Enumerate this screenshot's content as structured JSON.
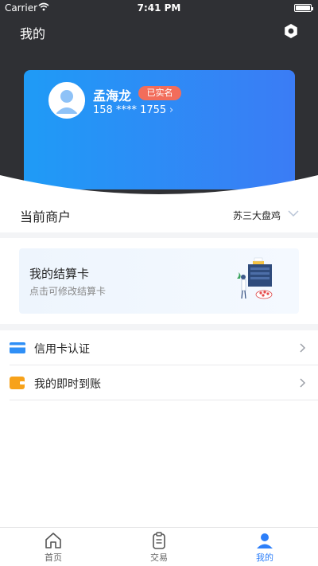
{
  "status_bar": {
    "carrier": "Carrier",
    "time": "7:41 PM"
  },
  "header": {
    "title": "我的"
  },
  "profile": {
    "name": "孟海龙",
    "badge": "已实名",
    "phone": "158 **** 1755"
  },
  "merchant": {
    "label": "当前商户",
    "value": "苏三大盘鸡"
  },
  "settlement_card": {
    "title": "我的结算卡",
    "subtitle": "点击可修改结算卡"
  },
  "menu": [
    {
      "label": "信用卡认证",
      "icon": "credit-card-icon"
    },
    {
      "label": "我的即时到账",
      "icon": "wallet-icon"
    }
  ],
  "tabs": [
    {
      "label": "首页",
      "icon": "home-icon",
      "active": false
    },
    {
      "label": "交易",
      "icon": "clipboard-icon",
      "active": false
    },
    {
      "label": "我的",
      "icon": "user-icon",
      "active": true
    }
  ],
  "colors": {
    "header_bg": "#2f3034",
    "accent": "#2d7ff9",
    "badge": "#f26d5b",
    "card_gradient_start": "#1f9bf6",
    "card_gradient_end": "#3b7cf5"
  }
}
